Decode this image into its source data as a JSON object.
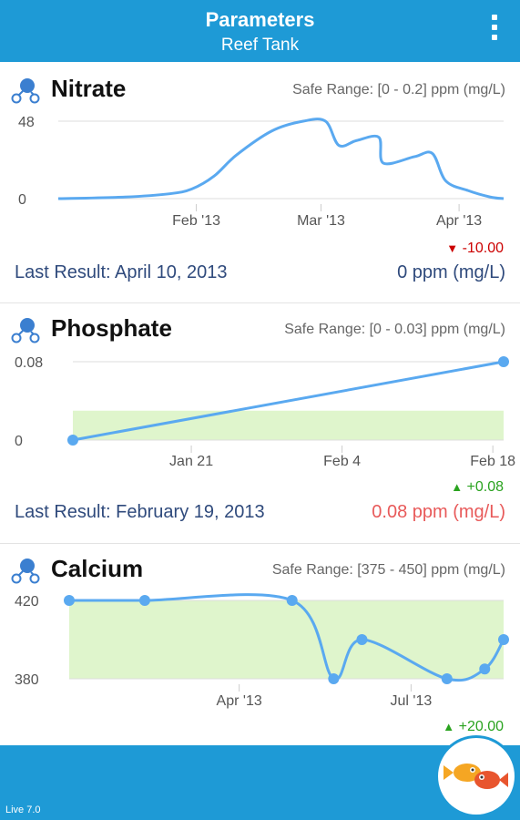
{
  "header": {
    "title": "Parameters",
    "subtitle": "Reef Tank"
  },
  "colors": {
    "appbar": "#1e9ad6",
    "line": "#5aa9f0",
    "safe_fill": "#dff5cc",
    "down": "#cc0000",
    "up": "#2aa31f",
    "out_of_range": "#e85a5a",
    "result": "#2f4a7c"
  },
  "icons": {
    "menu": "overflow-menu-icon",
    "parameter": "molecule-icon",
    "logo": "fish-logo-icon"
  },
  "parameters": [
    {
      "name": "Nitrate",
      "safe_range": "Safe Range: [0 - 0.2] ppm (mg/L)",
      "delta": "-10.00",
      "delta_direction": "down",
      "last_result_label": "Last Result: April 10, 2013",
      "last_result_value": "0 ppm (mg/L)"
    },
    {
      "name": "Phosphate",
      "safe_range": "Safe Range: [0 - 0.03] ppm (mg/L)",
      "delta": "+0.08",
      "delta_direction": "up",
      "last_result_label": "Last Result: February 19, 2013",
      "last_result_value": "0.08 ppm (mg/L)"
    },
    {
      "name": "Calcium",
      "safe_range": "Safe Range: [375 - 450] ppm (mg/L)",
      "delta": "+20.00",
      "delta_direction": "up"
    }
  ],
  "chart_data": [
    {
      "type": "area",
      "title": "Nitrate",
      "y_ticks": [
        "48",
        "0"
      ],
      "ylim": [
        0,
        48
      ],
      "x_ticks": [
        "Feb '13",
        "Mar '13",
        "Apr '13"
      ],
      "x_tick_days": [
        31,
        59,
        90
      ],
      "xlim_days": [
        0,
        100
      ],
      "grid": true,
      "series": [
        {
          "days": [
            0,
            15,
            25,
            30,
            35,
            40,
            48,
            55,
            60,
            63,
            67,
            72,
            73,
            80,
            84,
            87,
            92,
            97,
            100
          ],
          "values": [
            0,
            1,
            3,
            6,
            14,
            27,
            42,
            48,
            48,
            33,
            36,
            38,
            22,
            26,
            28,
            11,
            5,
            1,
            0
          ]
        }
      ]
    },
    {
      "type": "line",
      "title": "Phosphate",
      "y_ticks": [
        "0.08",
        "0"
      ],
      "ylim": [
        0,
        0.08
      ],
      "x_ticks": [
        "Jan 21",
        "Feb 4",
        "Feb 18"
      ],
      "x_tick_days": [
        20,
        34,
        48
      ],
      "xlim_days": [
        9,
        49
      ],
      "safe_band": [
        0,
        0.03
      ],
      "series": [
        {
          "days": [
            9,
            49
          ],
          "values": [
            0,
            0.08
          ]
        }
      ]
    },
    {
      "type": "line",
      "title": "Calcium",
      "y_ticks": [
        "420",
        "380"
      ],
      "ylim": [
        380,
        420
      ],
      "x_ticks": [
        "Apr '13",
        "Jul '13"
      ],
      "x_tick_days": [
        90,
        181
      ],
      "xlim_days": [
        0,
        230
      ],
      "safe_band": [
        375,
        420
      ],
      "series": [
        {
          "days": [
            0,
            40,
            118,
            140,
            155,
            200,
            220,
            230
          ],
          "values": [
            420,
            420,
            420,
            380,
            400,
            380,
            385,
            400
          ]
        }
      ]
    }
  ]
}
